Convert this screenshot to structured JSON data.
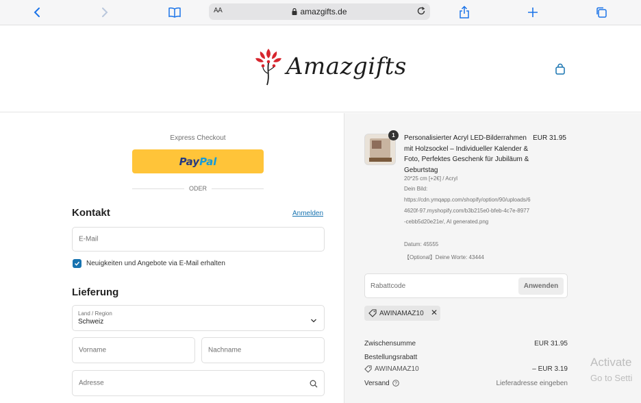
{
  "browser": {
    "text_size_label": "AA",
    "url": "amazgifts.de"
  },
  "header": {
    "logo_text": "Amazgifts"
  },
  "checkout": {
    "express_label": "Express Checkout",
    "paypal_pay": "Pay",
    "paypal_pal": "Pal",
    "or_label": "ODER",
    "contact": {
      "heading": "Kontakt",
      "login_link": "Anmelden",
      "email_placeholder": "E-Mail",
      "newsletter_label": "Neuigkeiten und Angebote via E-Mail erhalten",
      "newsletter_checked": true
    },
    "delivery": {
      "heading": "Lieferung",
      "country_label": "Land / Region",
      "country_value": "Schweiz",
      "first_name_placeholder": "Vorname",
      "last_name_placeholder": "Nachname",
      "address_placeholder": "Adresse"
    }
  },
  "summary": {
    "item": {
      "quantity": "1",
      "title": "Personalisierter Acryl LED-Bilderrahmen mit Holzsockel – Individueller Kalender & Foto, Perfektes Geschenk für Jubiläum & Geburtstag",
      "price": "EUR 31.95",
      "variant": "20*25 cm [+2€] / Acryl",
      "image_label": "Dein Bild:",
      "image_url": "https://cdn.ymqapp.com/shopify/option/90/uploads/64620f-97.myshopify.com/b3b215e0-bfeb-4c7e-8977-cebb5d20e21e/, AI generated.png",
      "date": "Datum: 45555",
      "words": "【Optional】Deine Worte: 43444"
    },
    "discount_placeholder": "Rabattcode",
    "apply_label": "Anwenden",
    "applied_code": "AWINAMAZ10",
    "subtotal_label": "Zwischensumme",
    "subtotal_value": "EUR 31.95",
    "order_discount_label": "Bestellungsrabatt",
    "order_discount_code": "AWINAMAZ10",
    "order_discount_value": "– EUR 3.19",
    "shipping_label": "Versand",
    "shipping_value": "Lieferadresse eingeben"
  },
  "os_overlay": {
    "line1": "Activate",
    "line2": "Go to Setti"
  },
  "colors": {
    "paypal_yellow": "#ffc439",
    "link_blue": "#1773b0",
    "logo_red": "#d7262e"
  }
}
